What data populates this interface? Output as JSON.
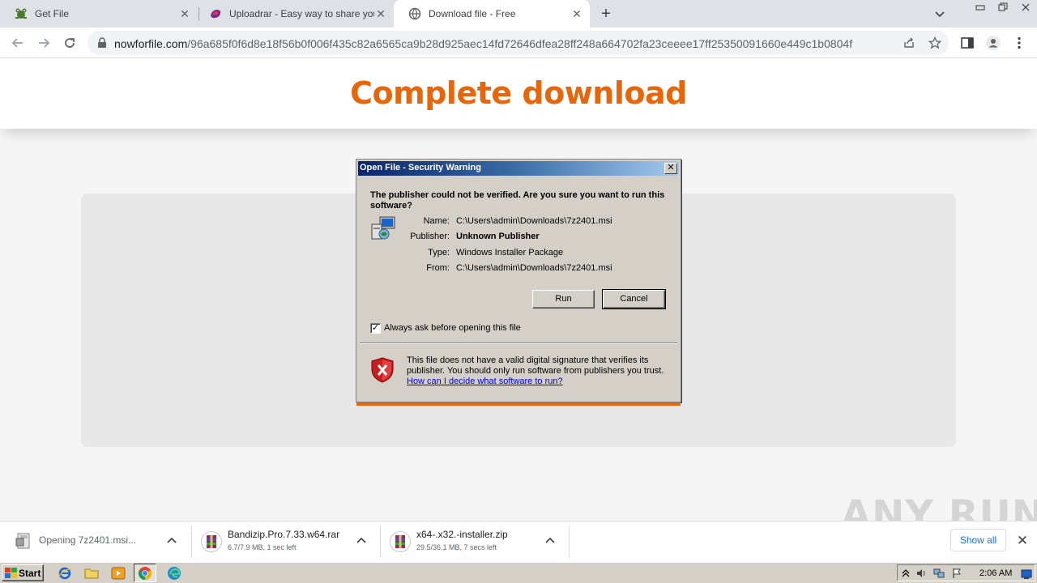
{
  "browser": {
    "tabs": [
      {
        "title": "Get File",
        "icon": "frog-icon",
        "active": false
      },
      {
        "title": "Uploadrar - Easy way to share your",
        "icon": "uploadrar-icon",
        "active": false
      },
      {
        "title": "Download file - Free",
        "icon": "globe-icon",
        "active": true
      }
    ],
    "tab_close_glyph": "✕",
    "new_tab_glyph": "+",
    "url_host": "nowforfile.com",
    "url_path": "/96a685f0f6d8e18f56b0f006f435c82a6565ca9b28d925aec14fd72646dfea28ff248a664702fa23ceeee17ff25350091660e449c1b0804f"
  },
  "page": {
    "title": "Complete download",
    "accent_color": "#e8650a"
  },
  "dialog": {
    "title": "Open File - Security Warning",
    "close_glyph": "✕",
    "question": "The publisher could not be verified.  Are you sure you want to run this software?",
    "fields": [
      {
        "key": "Name:",
        "value": "C:\\Users\\admin\\Downloads\\7z2401.msi",
        "bold": false
      },
      {
        "key": "Publisher:",
        "value": "Unknown Publisher",
        "bold": true
      },
      {
        "key": "Type:",
        "value": "Windows Installer Package",
        "bold": false
      },
      {
        "key": "From:",
        "value": "C:\\Users\\admin\\Downloads\\7z2401.msi",
        "bold": false
      }
    ],
    "run_label": "Run",
    "cancel_label": "Cancel",
    "checkbox_label": "Always ask before opening this file",
    "checkbox_checked": true,
    "checkbox_glyph": "✓",
    "warning_text": "This file does not have a valid digital signature that verifies its publisher.  You should only run software from publishers you trust.",
    "help_link": "How can I decide what software to run?"
  },
  "downloads": {
    "items": [
      {
        "name": "Opening 7z2401.msi...",
        "status": "",
        "icon": "msi-file-icon"
      },
      {
        "name": "Bandizip.Pro.7.33.w64.rar",
        "status": "6.7/7.9 MB, 1 sec left",
        "icon": "rar-archive-icon"
      },
      {
        "name": "x64-.x32.-installer.zip",
        "status": "29.5/36.1 MB, 7 secs left",
        "icon": "rar-archive-icon"
      }
    ],
    "show_all_label": "Show all",
    "close_glyph": "✕"
  },
  "watermark": "ANY RUN",
  "taskbar": {
    "start_label": "Start",
    "clock": "2:06 AM"
  }
}
